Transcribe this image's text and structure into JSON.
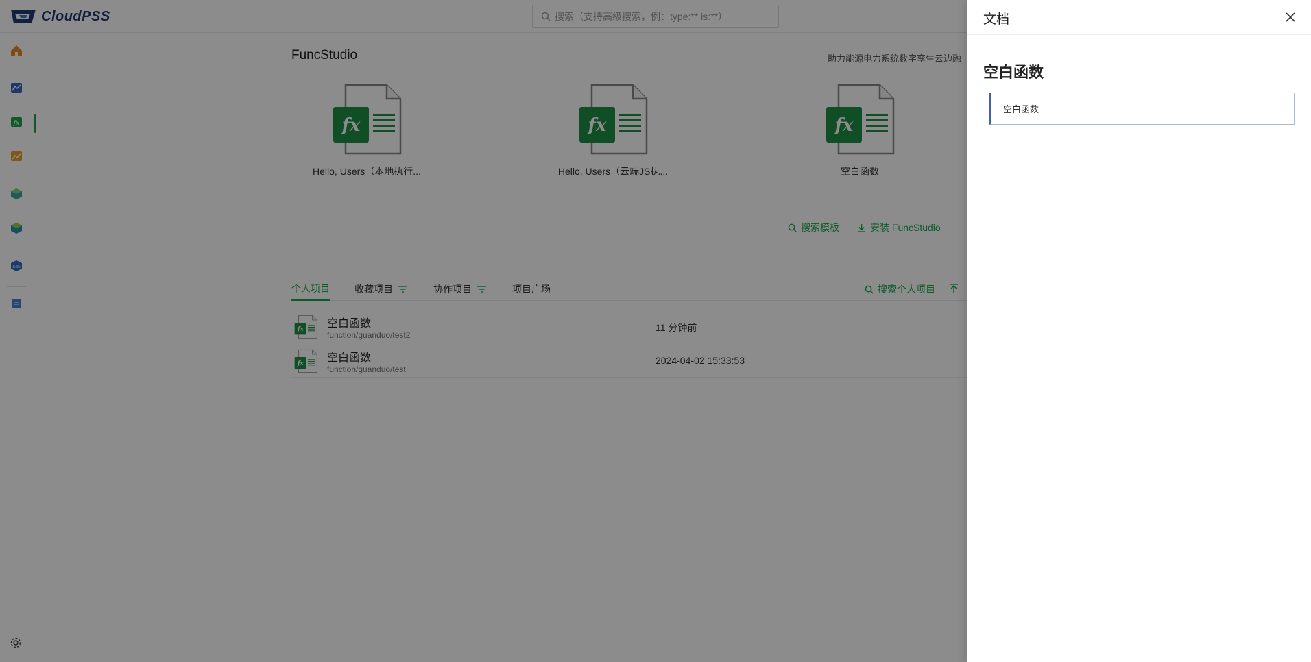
{
  "app": {
    "logo_text": "CloudPSS",
    "search": {
      "placeholder": "搜索（支持高级搜索，例：type:** is:**）"
    },
    "sidebar": {
      "items": [
        {
          "name": "home",
          "icon": "home-icon",
          "color": "#e8892b"
        },
        {
          "name": "emt",
          "icon": "chart-icon",
          "color": "#3a66c4"
        },
        {
          "name": "funcstudio",
          "icon": "function-icon",
          "color": "#1aa74b",
          "active": true
        },
        {
          "name": "analysis",
          "icon": "trend-icon",
          "color": "#e8a12b"
        },
        {
          "name": "app1",
          "icon": "cube-icon",
          "color": "#3aa5a0"
        },
        {
          "name": "app2",
          "icon": "cube-icon",
          "color": "#5a9f3a"
        },
        {
          "name": "sdk",
          "icon": "sdk-icon",
          "color": "#2d6fc4"
        },
        {
          "name": "docs",
          "icon": "document-icon",
          "color": "#4a7fd4"
        }
      ]
    }
  },
  "main": {
    "title": "FuncStudio",
    "slogan": "助力能源电力系统数字孪生云边融",
    "templates": [
      {
        "name": "Hello, Users（本地执行..."
      },
      {
        "name": "Hello, Users（云端JS执..."
      },
      {
        "name": "空白函数"
      }
    ],
    "actions": {
      "search_templates": "搜索模板",
      "install": "安装 FuncStudio"
    },
    "tabs": [
      {
        "label": "个人项目",
        "active": true
      },
      {
        "label": "收藏项目",
        "filter": true
      },
      {
        "label": "协作项目",
        "filter": true
      },
      {
        "label": "项目广场"
      }
    ],
    "search_personal": "搜索个人项目",
    "projects": [
      {
        "name": "空白函数",
        "path": "function/guanduo/test2",
        "time": "11 分钟前"
      },
      {
        "name": "空白函数",
        "path": "function/guanduo/test",
        "time": "2024-04-02 15:33:53"
      }
    ]
  },
  "drawer": {
    "title": "文档",
    "heading": "空白函数",
    "quote": "空白函数"
  },
  "colors": {
    "accent": "#1aa74b",
    "quote_border": "#3e63a8",
    "overlay": "rgba(0,0,0,0.45)"
  }
}
